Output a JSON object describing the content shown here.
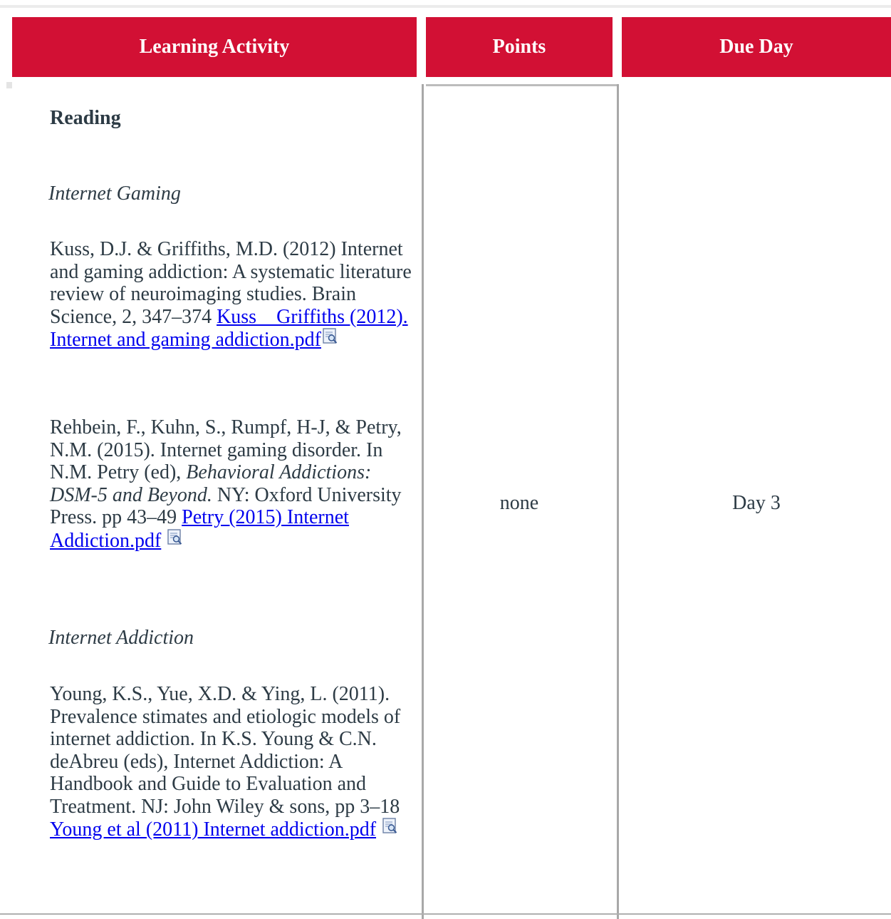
{
  "table": {
    "headers": {
      "activity": "Learning Activity",
      "points": "Points",
      "due": "Due Day"
    },
    "row": {
      "points": "none",
      "due_day": "Day 3",
      "activity": {
        "section_title": "Reading",
        "topic_gaming": "Internet Gaming",
        "topic_addiction": "Internet Addiction",
        "references": [
          {
            "citation": "Kuss, D.J. & Griffiths, M.D. (2012) Internet and gaming addiction: A systematic literature review of neuroimaging studies. Brain Science, 2, 347–374 ",
            "link_text": "Kuss _ Griffiths (2012). Internet and gaming addiction.pdf"
          },
          {
            "citation_before": "Rehbein, F., Kuhn, S., Rumpf, H-J, & Petry, N.M. (2015). Internet gaming disorder. In N.M. Petry (ed), ",
            "citation_italic": "Behavioral Addictions: DSM-5 and Beyond.",
            "citation_after": " NY: Oxford University Press. pp 43–49 ",
            "link_text": "Petry (2015) Internet Addiction.pdf"
          },
          {
            "citation": "Young, K.S., Yue, X.D. & Ying, L. (2011). Prevalence stimates and etiologic models of internet addiction. In K.S. Young & C.N. deAbreu (eds), Internet Addiction: A Handbook and Guide to Evaluation and Treatment. NJ: John Wiley & sons, pp 3–18 ",
            "link_text": "Young et al (2011) Internet addiction.pdf"
          }
        ]
      }
    }
  },
  "colors": {
    "header_bg": "#d21034",
    "header_text": "#ffffff",
    "body_text": "#2d3b45",
    "link": "#0000ee"
  },
  "icons": {
    "file_preview": "document-preview-icon"
  }
}
